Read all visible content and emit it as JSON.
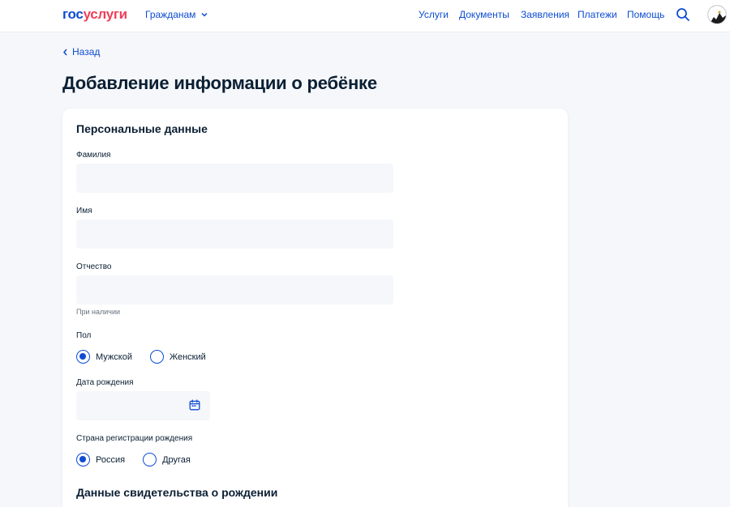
{
  "header": {
    "logo_part1": "гос",
    "logo_part2": "услуги",
    "role_label": "Гражданам",
    "nav": [
      "Услуги",
      "Документы",
      "Заявления",
      "Платежи",
      "Помощь"
    ],
    "search_icon": "search-icon",
    "avatar": "user-avatar"
  },
  "back_label": "Назад",
  "page_title": "Добавление информации о ребёнке",
  "personal": {
    "title": "Персональные данные",
    "surname_label": "Фамилия",
    "surname_value": "",
    "name_label": "Имя",
    "name_value": "",
    "patronymic_label": "Отчество",
    "patronymic_value": "",
    "patronymic_hint": "При наличии",
    "gender_label": "Пол",
    "gender_options": [
      "Мужской",
      "Женский"
    ],
    "gender_selected": "Мужской",
    "birthdate_label": "Дата рождения",
    "birthdate_value": "",
    "country_label": "Страна регистрации рождения",
    "country_options": [
      "Россия",
      "Другая"
    ],
    "country_selected": "Россия"
  },
  "certificate": {
    "title": "Данные свидетельства о рождении"
  },
  "colors": {
    "accent": "#0d4cd3",
    "logo_red": "#ee3f58",
    "background": "#f5f7fa",
    "text": "#0b1f33"
  }
}
